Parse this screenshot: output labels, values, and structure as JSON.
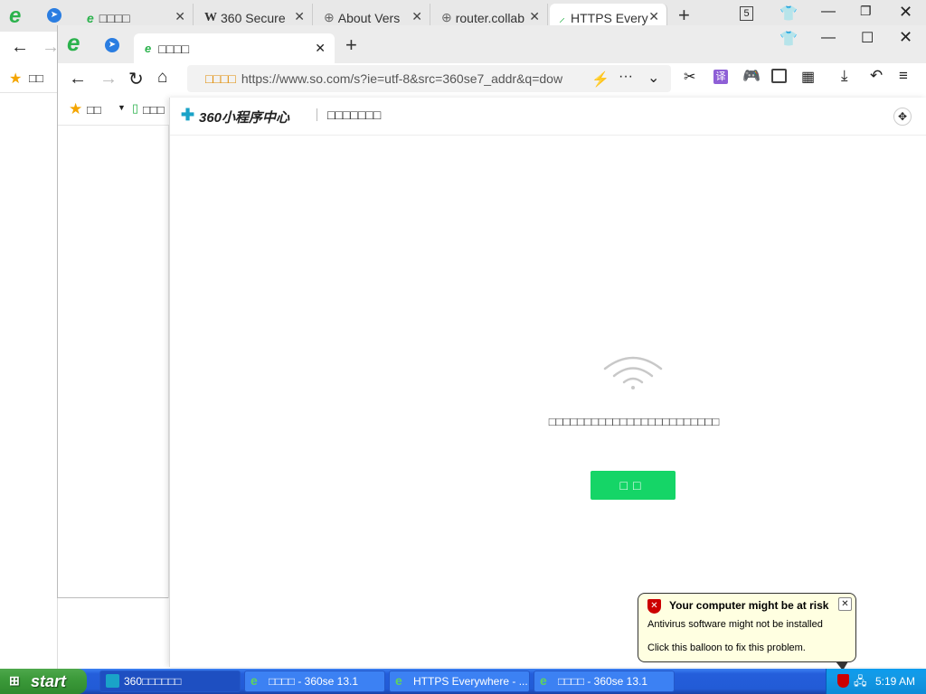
{
  "back_browser": {
    "tabs": [
      {
        "label": "□□□□",
        "close": "✕"
      },
      {
        "label": "360 Secure",
        "close": "✕"
      },
      {
        "label": "About Vers",
        "close": "✕"
      },
      {
        "label": "router.collab",
        "close": "✕"
      },
      {
        "label": "HTTPS Every",
        "close": "✕"
      }
    ],
    "new_tab": "+",
    "tab_count": "5",
    "bookmarks_label": "□□"
  },
  "front_browser": {
    "tab_label": "□□□□",
    "tab_close": "✕",
    "new_tab": "+",
    "address_prefix": "□□□□",
    "address_url": "https://www.so.com/s?ie=utf-8&src=360se7_addr&q=dow",
    "more": "···",
    "translate_icon_text": "译",
    "bookmarks_label": "□□",
    "bookmark_2": "□□□"
  },
  "panel": {
    "brand": "360小程序中心",
    "title": "□□□□□□□",
    "message": "□□□□□□□□□□□□□□□□□□□□□□□□",
    "retry_label": "□□"
  },
  "balloon": {
    "title": "Your computer might be at risk",
    "line1": "Antivirus software might not be installed",
    "line2": "Click this balloon to fix this problem.",
    "close": "✕"
  },
  "taskbar": {
    "start": "start",
    "tasks": [
      {
        "label": "360□□□□□□"
      },
      {
        "label": "□□□□ - 360se 13.1"
      },
      {
        "label": "HTTPS Everywhere - ..."
      },
      {
        "label": "□□□□ - 360se 13.1"
      }
    ],
    "clock": "5:19 AM"
  },
  "colors": {
    "accent_green": "#15d567",
    "xp_blue": "#245edb",
    "balloon_bg": "#ffffe1"
  }
}
